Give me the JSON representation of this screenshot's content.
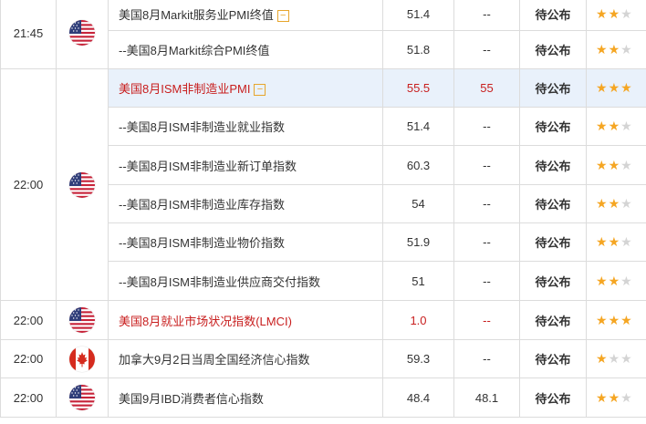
{
  "columns": {
    "time": "",
    "country": "",
    "event": "",
    "actual": "",
    "forecast": "",
    "status": "",
    "importance": ""
  },
  "groups": [
    {
      "time": "21:45",
      "flag_icon": "us-flag-icon",
      "rows": [
        {
          "name": "美国8月Markit服务业PMI终值",
          "actual": "51.4",
          "forecast": "--",
          "status": "待公布",
          "stars": 2,
          "toggle": "−",
          "red": false,
          "hl": false
        },
        {
          "name": "--美国8月Markit综合PMI终值",
          "actual": "51.8",
          "forecast": "--",
          "status": "待公布",
          "stars": 2,
          "toggle": "",
          "red": false,
          "hl": false
        }
      ]
    },
    {
      "time": "22:00",
      "flag_icon": "us-flag-icon",
      "rows": [
        {
          "name": "美国8月ISM非制造业PMI",
          "actual": "55.5",
          "forecast": "55",
          "status": "待公布",
          "stars": 3,
          "toggle": "−",
          "red": true,
          "hl": true
        },
        {
          "name": "--美国8月ISM非制造业就业指数",
          "actual": "51.4",
          "forecast": "--",
          "status": "待公布",
          "stars": 2,
          "toggle": "",
          "red": false,
          "hl": false
        },
        {
          "name": "--美国8月ISM非制造业新订单指数",
          "actual": "60.3",
          "forecast": "--",
          "status": "待公布",
          "stars": 2,
          "toggle": "",
          "red": false,
          "hl": false
        },
        {
          "name": "--美国8月ISM非制造业库存指数",
          "actual": "54",
          "forecast": "--",
          "status": "待公布",
          "stars": 2,
          "toggle": "",
          "red": false,
          "hl": false
        },
        {
          "name": "--美国8月ISM非制造业物价指数",
          "actual": "51.9",
          "forecast": "--",
          "status": "待公布",
          "stars": 2,
          "toggle": "",
          "red": false,
          "hl": false
        },
        {
          "name": "--美国8月ISM非制造业供应商交付指数",
          "actual": "51",
          "forecast": "--",
          "status": "待公布",
          "stars": 2,
          "toggle": "",
          "red": false,
          "hl": false
        }
      ]
    },
    {
      "time": "22:00",
      "flag_icon": "us-flag-icon",
      "rows": [
        {
          "name": "美国8月就业市场状况指数(LMCI)",
          "actual": "1.0",
          "forecast": "--",
          "status": "待公布",
          "stars": 3,
          "toggle": "",
          "red": true,
          "hl": false
        }
      ]
    },
    {
      "time": "22:00",
      "flag_icon": "canada-flag-icon",
      "rows": [
        {
          "name": "加拿大9月2日当周全国经济信心指数",
          "actual": "59.3",
          "forecast": "--",
          "status": "待公布",
          "stars": 1,
          "toggle": "",
          "red": false,
          "hl": false
        }
      ]
    },
    {
      "time": "22:00",
      "flag_icon": "us-flag-icon",
      "rows": [
        {
          "name": "美国9月IBD消费者信心指数",
          "actual": "48.4",
          "forecast": "48.1",
          "status": "待公布",
          "stars": 2,
          "toggle": "",
          "red": false,
          "hl": false
        }
      ]
    }
  ],
  "colors": {
    "accent_red": "#c81e1e",
    "star_on": "#f5a623",
    "star_off": "#d4d4d4",
    "highlight": "#e9f1fb",
    "border": "#dcdcdc"
  }
}
